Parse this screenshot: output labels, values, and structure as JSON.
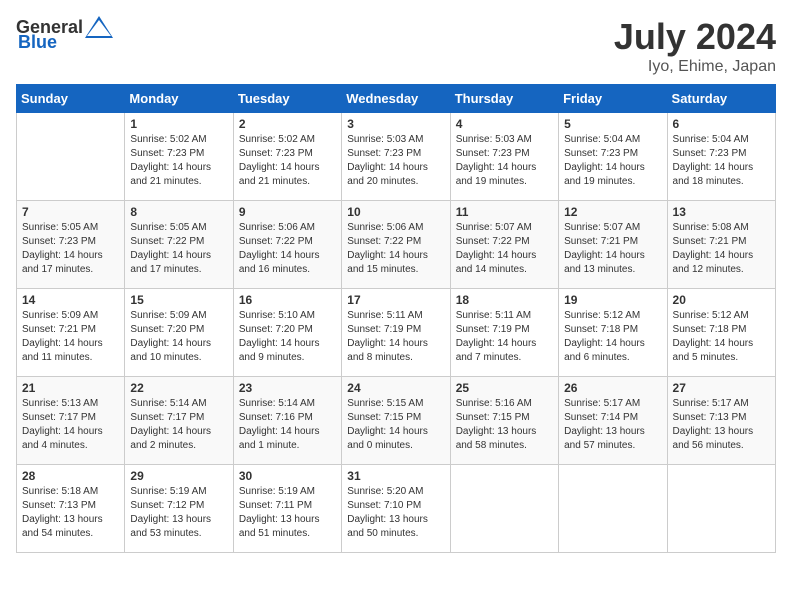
{
  "header": {
    "logo_general": "General",
    "logo_blue": "Blue",
    "month": "July 2024",
    "location": "Iyo, Ehime, Japan"
  },
  "days_of_week": [
    "Sunday",
    "Monday",
    "Tuesday",
    "Wednesday",
    "Thursday",
    "Friday",
    "Saturday"
  ],
  "weeks": [
    [
      {
        "day": "",
        "info": ""
      },
      {
        "day": "1",
        "info": "Sunrise: 5:02 AM\nSunset: 7:23 PM\nDaylight: 14 hours\nand 21 minutes."
      },
      {
        "day": "2",
        "info": "Sunrise: 5:02 AM\nSunset: 7:23 PM\nDaylight: 14 hours\nand 21 minutes."
      },
      {
        "day": "3",
        "info": "Sunrise: 5:03 AM\nSunset: 7:23 PM\nDaylight: 14 hours\nand 20 minutes."
      },
      {
        "day": "4",
        "info": "Sunrise: 5:03 AM\nSunset: 7:23 PM\nDaylight: 14 hours\nand 19 minutes."
      },
      {
        "day": "5",
        "info": "Sunrise: 5:04 AM\nSunset: 7:23 PM\nDaylight: 14 hours\nand 19 minutes."
      },
      {
        "day": "6",
        "info": "Sunrise: 5:04 AM\nSunset: 7:23 PM\nDaylight: 14 hours\nand 18 minutes."
      }
    ],
    [
      {
        "day": "7",
        "info": "Sunrise: 5:05 AM\nSunset: 7:23 PM\nDaylight: 14 hours\nand 17 minutes."
      },
      {
        "day": "8",
        "info": "Sunrise: 5:05 AM\nSunset: 7:22 PM\nDaylight: 14 hours\nand 17 minutes."
      },
      {
        "day": "9",
        "info": "Sunrise: 5:06 AM\nSunset: 7:22 PM\nDaylight: 14 hours\nand 16 minutes."
      },
      {
        "day": "10",
        "info": "Sunrise: 5:06 AM\nSunset: 7:22 PM\nDaylight: 14 hours\nand 15 minutes."
      },
      {
        "day": "11",
        "info": "Sunrise: 5:07 AM\nSunset: 7:22 PM\nDaylight: 14 hours\nand 14 minutes."
      },
      {
        "day": "12",
        "info": "Sunrise: 5:07 AM\nSunset: 7:21 PM\nDaylight: 14 hours\nand 13 minutes."
      },
      {
        "day": "13",
        "info": "Sunrise: 5:08 AM\nSunset: 7:21 PM\nDaylight: 14 hours\nand 12 minutes."
      }
    ],
    [
      {
        "day": "14",
        "info": "Sunrise: 5:09 AM\nSunset: 7:21 PM\nDaylight: 14 hours\nand 11 minutes."
      },
      {
        "day": "15",
        "info": "Sunrise: 5:09 AM\nSunset: 7:20 PM\nDaylight: 14 hours\nand 10 minutes."
      },
      {
        "day": "16",
        "info": "Sunrise: 5:10 AM\nSunset: 7:20 PM\nDaylight: 14 hours\nand 9 minutes."
      },
      {
        "day": "17",
        "info": "Sunrise: 5:11 AM\nSunset: 7:19 PM\nDaylight: 14 hours\nand 8 minutes."
      },
      {
        "day": "18",
        "info": "Sunrise: 5:11 AM\nSunset: 7:19 PM\nDaylight: 14 hours\nand 7 minutes."
      },
      {
        "day": "19",
        "info": "Sunrise: 5:12 AM\nSunset: 7:18 PM\nDaylight: 14 hours\nand 6 minutes."
      },
      {
        "day": "20",
        "info": "Sunrise: 5:12 AM\nSunset: 7:18 PM\nDaylight: 14 hours\nand 5 minutes."
      }
    ],
    [
      {
        "day": "21",
        "info": "Sunrise: 5:13 AM\nSunset: 7:17 PM\nDaylight: 14 hours\nand 4 minutes."
      },
      {
        "day": "22",
        "info": "Sunrise: 5:14 AM\nSunset: 7:17 PM\nDaylight: 14 hours\nand 2 minutes."
      },
      {
        "day": "23",
        "info": "Sunrise: 5:14 AM\nSunset: 7:16 PM\nDaylight: 14 hours\nand 1 minute."
      },
      {
        "day": "24",
        "info": "Sunrise: 5:15 AM\nSunset: 7:15 PM\nDaylight: 14 hours\nand 0 minutes."
      },
      {
        "day": "25",
        "info": "Sunrise: 5:16 AM\nSunset: 7:15 PM\nDaylight: 13 hours\nand 58 minutes."
      },
      {
        "day": "26",
        "info": "Sunrise: 5:17 AM\nSunset: 7:14 PM\nDaylight: 13 hours\nand 57 minutes."
      },
      {
        "day": "27",
        "info": "Sunrise: 5:17 AM\nSunset: 7:13 PM\nDaylight: 13 hours\nand 56 minutes."
      }
    ],
    [
      {
        "day": "28",
        "info": "Sunrise: 5:18 AM\nSunset: 7:13 PM\nDaylight: 13 hours\nand 54 minutes."
      },
      {
        "day": "29",
        "info": "Sunrise: 5:19 AM\nSunset: 7:12 PM\nDaylight: 13 hours\nand 53 minutes."
      },
      {
        "day": "30",
        "info": "Sunrise: 5:19 AM\nSunset: 7:11 PM\nDaylight: 13 hours\nand 51 minutes."
      },
      {
        "day": "31",
        "info": "Sunrise: 5:20 AM\nSunset: 7:10 PM\nDaylight: 13 hours\nand 50 minutes."
      },
      {
        "day": "",
        "info": ""
      },
      {
        "day": "",
        "info": ""
      },
      {
        "day": "",
        "info": ""
      }
    ]
  ]
}
